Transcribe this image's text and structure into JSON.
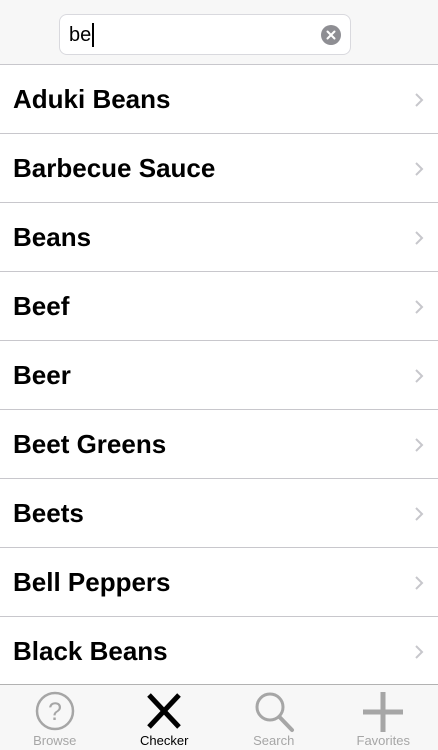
{
  "search": {
    "value": "be",
    "placeholder": ""
  },
  "results": [
    {
      "label": "Aduki Beans"
    },
    {
      "label": "Barbecue Sauce"
    },
    {
      "label": "Beans"
    },
    {
      "label": "Beef"
    },
    {
      "label": "Beer"
    },
    {
      "label": "Beet Greens"
    },
    {
      "label": "Beets"
    },
    {
      "label": "Bell Peppers"
    },
    {
      "label": "Black Beans"
    }
  ],
  "tabs": [
    {
      "label": "Browse",
      "icon": "question-circle-icon",
      "active": false
    },
    {
      "label": "Checker",
      "icon": "x-mark-icon",
      "active": true
    },
    {
      "label": "Search",
      "icon": "magnifier-icon",
      "active": false
    },
    {
      "label": "Favorites",
      "icon": "plus-icon",
      "active": false
    }
  ],
  "colors": {
    "active_tab": "#000000",
    "inactive_tab": "#a6a6a6",
    "separator": "#c8c7cc",
    "bar_background": "#f7f7f7"
  }
}
